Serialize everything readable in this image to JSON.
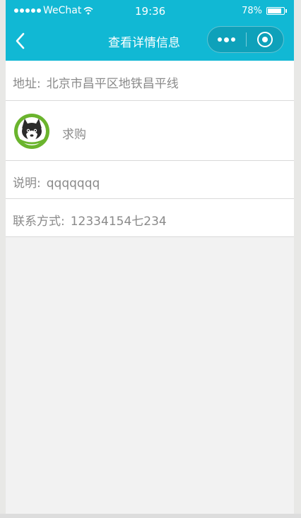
{
  "status_bar": {
    "carrier": "WeChat",
    "time": "19:36",
    "battery_percent": "78%",
    "battery_level": 0.78
  },
  "nav": {
    "title": "查看详情信息",
    "back_icon": "chevron-left-icon",
    "more_icon": "more-dots-icon",
    "close_icon": "target-circle-icon"
  },
  "detail": {
    "address_label": "地址:",
    "address_value": "北京市昌平区地铁昌平线",
    "type_label": "求购",
    "description_label": "说明:",
    "description_value": "qqqqqqq",
    "contact_label": "联系方式:",
    "contact_value": "12334154七234"
  },
  "colors": {
    "accent": "#11b8d4",
    "page_background": "#f2f2f2",
    "text_muted": "#8a8a8a",
    "avatar_green": "#6ab42d"
  }
}
